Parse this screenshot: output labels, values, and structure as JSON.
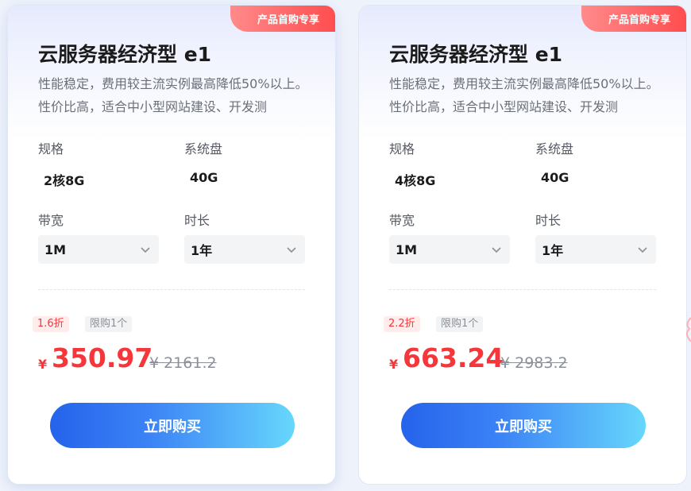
{
  "cards": [
    {
      "ribbon": "产品首购专享",
      "title": "云服务器经济型 e1",
      "desc": "性能稳定，费用较主流实例最高降低50%以上。性价比高，适合中小型网站建设、开发测",
      "spec_label": "规格",
      "spec_value": "2核8G",
      "disk_label": "系统盘",
      "disk_value": "40G",
      "bandwidth_label": "带宽",
      "bandwidth_value": "1M",
      "duration_label": "时长",
      "duration_value": "1年",
      "discount": "1.6折",
      "limit": "限购1个",
      "currency": "¥",
      "price": "350.97",
      "original_price": "¥ 2161.2",
      "buy_label": "立即购买"
    },
    {
      "ribbon": "产品首购专享",
      "title": "云服务器经济型 e1",
      "desc": "性能稳定，费用较主流实例最高降低50%以上。性价比高，适合中小型网站建设、开发测",
      "spec_label": "规格",
      "spec_value": "4核8G",
      "disk_label": "系统盘",
      "disk_value": "40G",
      "bandwidth_label": "带宽",
      "bandwidth_value": "1M",
      "duration_label": "时长",
      "duration_value": "1年",
      "discount": "2.2折",
      "limit": "限购1个",
      "currency": "¥",
      "price": "663.24",
      "original_price": "¥ 2983.2",
      "buy_label": "立即购买"
    }
  ],
  "colors": {
    "accent_red": "#f5363b",
    "button_start": "#2563eb",
    "button_end": "#67d7fb"
  },
  "icons": [
    "chevron-down-icon"
  ]
}
